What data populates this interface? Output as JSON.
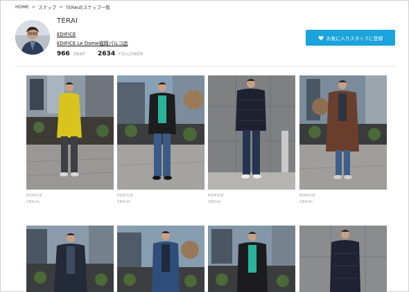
{
  "breadcrumb": [
    {
      "label": "HOME"
    },
    {
      "label": "スナップ"
    },
    {
      "label": "TERAIのスナップ一覧"
    }
  ],
  "breadcrumb_sep": ">",
  "profile": {
    "name": "TERAI",
    "brand": "EDIFICE",
    "shop": "EDIFICE Le Dome福岡パルコ店",
    "snap_count": "966",
    "snap_label": "SNAP",
    "follower_count": "2634",
    "follower_label": "FOLLOWER"
  },
  "favorite_button": {
    "label": "お気に入りスタッフに登録",
    "icon": "heart-icon"
  },
  "colors": {
    "accent": "#1ba3dc"
  },
  "snaps": [
    {
      "brand": "EDIFICE",
      "height": "183cm",
      "outfit": "yellow-rain-jacket"
    },
    {
      "brand": "EDIFICE",
      "height": "183cm",
      "outfit": "black-leather-jacket"
    },
    {
      "brand": "EDIFICE",
      "height": "183cm",
      "outfit": "navy-down-jacket"
    },
    {
      "brand": "EDIFICE",
      "height": "183cm",
      "outfit": "brown-long-coat"
    },
    {
      "brand": "",
      "height": "",
      "outfit": "navy-chester-coat"
    },
    {
      "brand": "",
      "height": "",
      "outfit": "denim-jacket"
    },
    {
      "brand": "",
      "height": "",
      "outfit": "black-leather-jacket-green-knit"
    },
    {
      "brand": "",
      "height": "",
      "outfit": "navy-down-parka"
    }
  ]
}
